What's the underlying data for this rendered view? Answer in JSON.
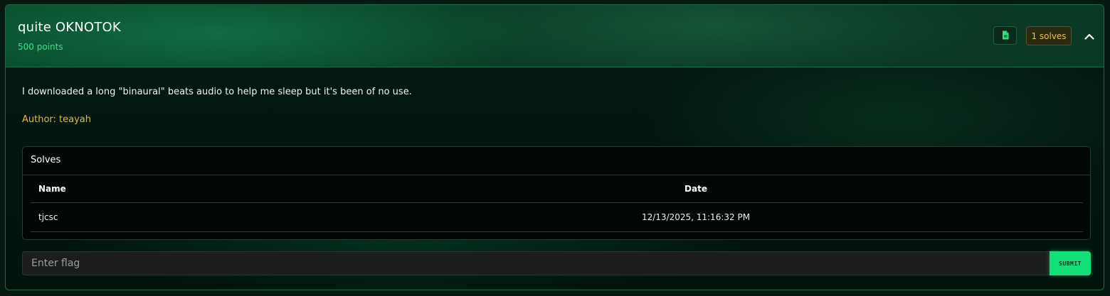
{
  "challenge": {
    "title": "quite OKNOTOK",
    "points_label": "500 points",
    "solves_badge": "1 solves",
    "description": "I downloaded a long \"binaural\" beats audio to help me sleep but it's been of no use.",
    "author": "Author: teayah"
  },
  "icons": {
    "file": "file-icon",
    "collapse": "chevron-up-icon"
  },
  "solves": {
    "title": "Solves",
    "columns": {
      "name": "Name",
      "date": "Date"
    },
    "rows": [
      {
        "name": "tjcsc",
        "date": "12/13/2025, 11:16:32 PM"
      }
    ]
  },
  "flag_form": {
    "placeholder": "Enter flag",
    "value": "",
    "submit_label": "SUBMIT"
  },
  "colors": {
    "accent_green": "#14e07a",
    "points_green": "#3ee08a",
    "author_gold": "#e6bb2b",
    "badge_gold": "#e8c53a"
  }
}
